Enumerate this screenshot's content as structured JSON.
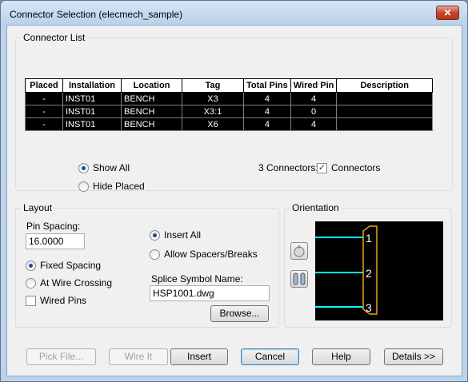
{
  "window": {
    "title": "Connector Selection  (elecmech_sample)",
    "close_glyph": "✕"
  },
  "connector_list": {
    "group_label": "Connector List",
    "columns": [
      "Placed",
      "Installation",
      "Location",
      "Tag",
      "Total Pins",
      "Wired Pin",
      "Description"
    ],
    "rows": [
      [
        "-",
        "INST01",
        "BENCH",
        "X3",
        "4",
        "4",
        ""
      ],
      [
        "-",
        "INST01",
        "BENCH",
        "X3:1",
        "4",
        "0",
        ""
      ],
      [
        "-",
        "INST01",
        "BENCH",
        "X6",
        "4",
        "4",
        ""
      ]
    ],
    "show_all_label": "Show All",
    "hide_placed_label": "Hide Placed",
    "count_label": "3 Connectors:",
    "connectors_checkbox_label": "Connectors",
    "connectors_checked": true,
    "show_all_selected": true
  },
  "layout": {
    "group_label": "Layout",
    "pin_spacing_label": "Pin Spacing:",
    "pin_spacing_value": "16.0000",
    "fixed_spacing_label": "Fixed Spacing",
    "at_wire_crossing_label": "At Wire Crossing",
    "wired_pins_label": "Wired Pins",
    "insert_all_label": "Insert All",
    "allow_spacers_label": "Allow Spacers/Breaks",
    "splice_symbol_label": "Splice Symbol Name:",
    "splice_symbol_value": "HSP1001.dwg",
    "browse_label": "Browse...",
    "fixed_spacing_selected": true,
    "insert_all_selected": true,
    "wired_pins_checked": false
  },
  "orientation": {
    "group_label": "Orientation",
    "pin_numbers": [
      "1",
      "2",
      "3"
    ],
    "colors": {
      "wire": "#00ffff",
      "outline": "#f0a020",
      "background": "#000000"
    }
  },
  "footer": {
    "pick_file_label": "Pick File...",
    "wire_it_label": "Wire It",
    "insert_label": "Insert",
    "cancel_label": "Cancel",
    "help_label": "Help",
    "details_label": "Details >>"
  }
}
